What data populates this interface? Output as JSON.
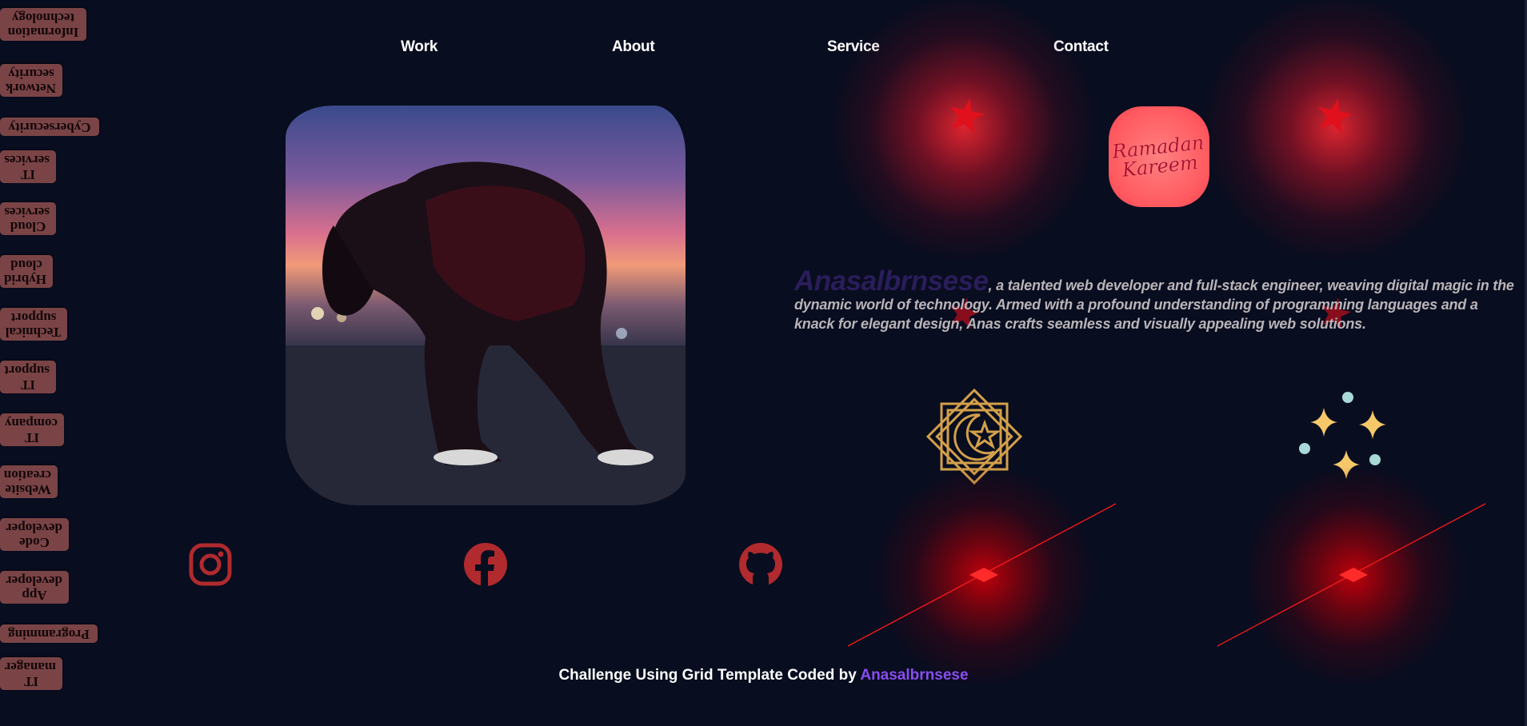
{
  "tags": [
    "Information technology",
    "Network security",
    "Cybersecurity",
    "IT services",
    "Cloud services",
    "Hybrid cloud",
    "Technical support",
    "IT support",
    "IT company",
    "Website creation",
    "Code developer",
    "App developer",
    "Programming",
    "IT manager"
  ],
  "nav": {
    "work": "Work",
    "about": "About",
    "service": "Service",
    "contact": "Contact"
  },
  "badge": {
    "text": "Ramadan Kareem"
  },
  "intro": {
    "name": "Anasalbrnsese",
    "text": ", a talented web developer and full-stack engineer, weaving digital magic in the dynamic world of technology. Armed with a profound understanding of programming languages and a knack for elegant design, Anas crafts seamless and visually appealing web solutions."
  },
  "social": {
    "instagram": "instagram-icon",
    "facebook": "facebook-icon",
    "github": "github-icon"
  },
  "footer": {
    "text": "Challenge Using Grid Template Coded by ",
    "author": "Anasalbrnsese"
  },
  "colors": {
    "background": "#080d1f",
    "accent_red": "#b02a2e",
    "author": "#8a4df0",
    "tag_bg": "#7a4446"
  }
}
